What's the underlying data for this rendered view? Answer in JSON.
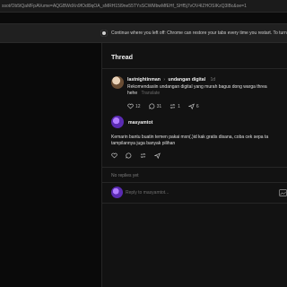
{
  "browser": {
    "url_fragment": "ssot/Ob5tQaMFpAVume=AQGBWdXn9fOdl9qOA_sMRH15l9ne55TYsSCWMbwMfEHf_SHf5j7vOV4IZHOSIKzQ3lBc&oe=1",
    "restore_message": "Continue where you left off: Chrome can restore your tabs every time you restart. To turn"
  },
  "thread": {
    "title": "Thread",
    "original_post": {
      "username": "lastnightinman",
      "separator": "›",
      "community": "undangan digital",
      "time": "1d",
      "text_line1": "Rekomendasiin undangan digital yang murah bagus dong warga threa",
      "text_line2": "hehe",
      "translate_label": "Translate",
      "likes": "12",
      "comments": "31",
      "reposts": "1",
      "shares": "6"
    },
    "reply": {
      "username": "masyamtot",
      "text_line1": "Kemarin bantu buatin temen pakai mxn(.)id kak gratis disana, coba cek sepa ta",
      "text_line2": "tampilannya juga banyak pilihan"
    },
    "no_replies": "No replies yet",
    "reply_placeholder": "Reply to masyamtot..."
  }
}
